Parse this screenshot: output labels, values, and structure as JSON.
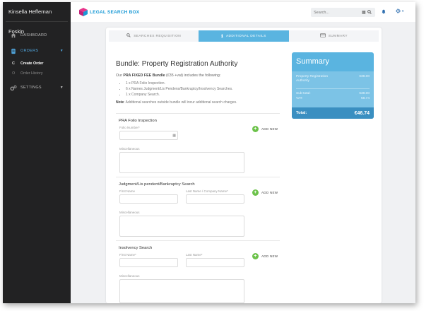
{
  "app": {
    "user_name": "Kinsella Heffernan Foskin",
    "logo_text": "LEGAL SEARCH BOX"
  },
  "sidebar": {
    "dashboard": "DASHBOARD",
    "orders": "ORDERS",
    "orders_sub": [
      {
        "letter": "C",
        "label": "Create Order"
      },
      {
        "letter": "O",
        "label": "Order History"
      }
    ],
    "settings": "SETTINGS"
  },
  "topbar": {
    "search_placeholder": "Search..."
  },
  "tabs": [
    {
      "label": "SEARCHES REQUISITION",
      "icon": "search-icon"
    },
    {
      "label": "ADDITIONAL DETAILS",
      "icon": "info-icon"
    },
    {
      "label": "SUMMARY",
      "icon": "card-icon"
    }
  ],
  "bundle": {
    "title": "Bundle: Property Registration Authority",
    "intro_pre": "Our ",
    "intro_bold": "PRA FIXED FEE Bundle",
    "intro_post": " (€35 +vat) includes the following:",
    "bullets": [
      "1 x PRA Folio Inspection.",
      "6 x Names Judgment/Lis Pendens/Bankruptcy/Insolvency Searches.",
      "1 x Company Search."
    ],
    "note_label": "Note",
    "note_text": ": Additional searches outside bundle will incur additional search charges."
  },
  "sections": {
    "folio": {
      "title": "PRA Folio Inspection",
      "folio_label": "Folio Number*",
      "misc_label": "Miscellaneous",
      "add_new": "ADD NEW"
    },
    "judgment": {
      "title": "Judgment/Lis pendent/Bankruptcy Search",
      "first_label": "First Name",
      "last_label": "Last Name / Company Name*",
      "misc_label": "Miscellaneous",
      "add_new": "ADD NEW"
    },
    "insolvency": {
      "title": "Insolvency Search",
      "first_label": "First Name*",
      "last_label": "Last Name*",
      "misc_label": "Miscellaneous",
      "add_new": "ADD NEW"
    }
  },
  "summary": {
    "title": "Summary",
    "line_item_label": "Property Registration Authority",
    "line_item_value": "€38.00",
    "subtotal_label": "Sub-total:",
    "subtotal_value": "€38.00",
    "vat_label": "VAT:",
    "vat_value": "€8.74",
    "total_label": "Total:",
    "total_value": "€46.74"
  },
  "colors": {
    "accent": "#5ab4e0",
    "sidebar": "#222223",
    "add_button": "#6cc24a"
  }
}
